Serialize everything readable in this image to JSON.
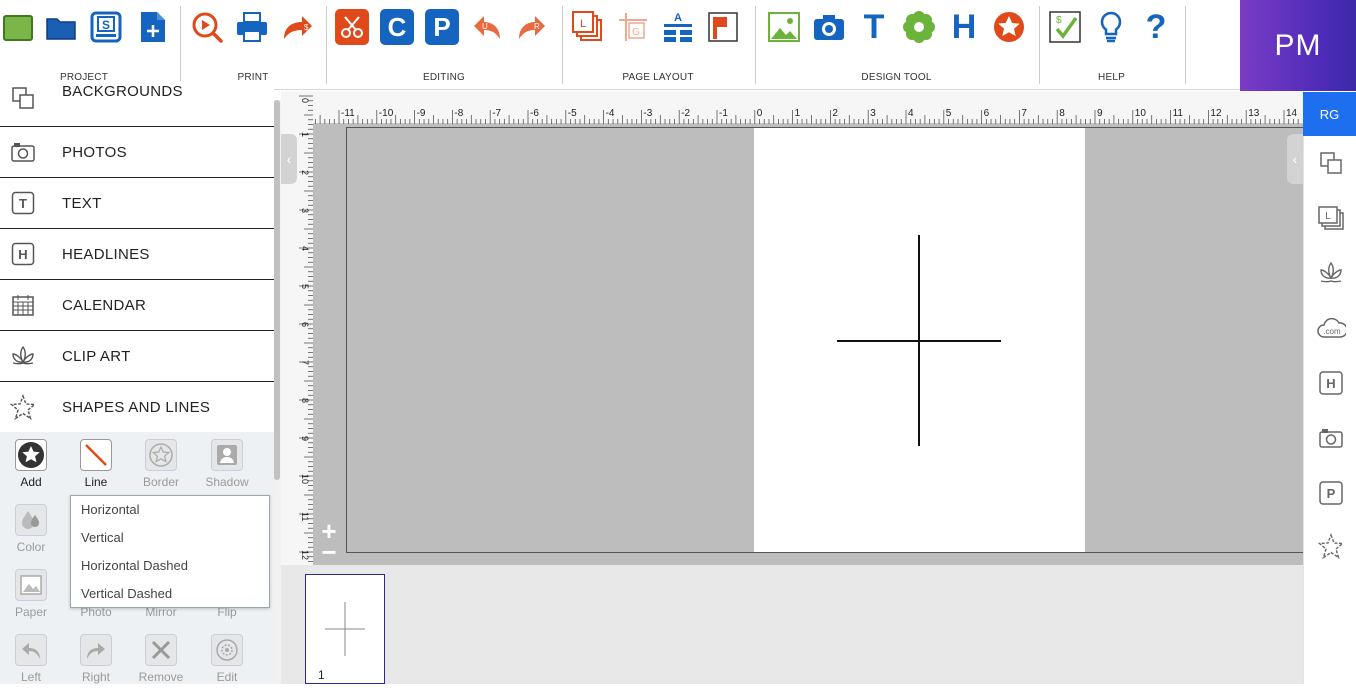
{
  "toolbar": {
    "groups": [
      {
        "label": "PROJECT"
      },
      {
        "label": "PRINT"
      },
      {
        "label": "EDITING"
      },
      {
        "label": "PAGE LAYOUT"
      },
      {
        "label": "DESIGN TOOL"
      },
      {
        "label": "HELP"
      }
    ],
    "icons": {
      "copy_c": "C",
      "paste_p": "P",
      "text_t": "T",
      "headline_h": "H",
      "question": "?",
      "layout_a": "A"
    }
  },
  "user": {
    "initials": "PM"
  },
  "left_menu": {
    "items": [
      {
        "label": "BACKGROUNDS"
      },
      {
        "label": "PHOTOS"
      },
      {
        "label": "TEXT"
      },
      {
        "label": "HEADLINES"
      },
      {
        "label": "CALENDAR"
      },
      {
        "label": "CLIP ART"
      },
      {
        "label": "SHAPES AND LINES"
      }
    ]
  },
  "shape_tools": {
    "add": "Add",
    "line": "Line",
    "border": "Border",
    "shadow": "Shadow",
    "color": "Color",
    "paper": "Paper",
    "photo": "Photo",
    "mirror": "Mirror",
    "flip": "Flip",
    "left": "Left",
    "right": "Right",
    "remove": "Remove",
    "edit": "Edit"
  },
  "line_dropdown": {
    "options": [
      "Horizontal",
      "Vertical",
      "Horizontal Dashed",
      "Vertical Dashed"
    ]
  },
  "ruler": {
    "top_labels": [
      "-11",
      "-10",
      "-9",
      "-8",
      "-7",
      "-6",
      "-5",
      "-4",
      "-3",
      "-2",
      "-1",
      "0",
      "1",
      "2",
      "3",
      "4",
      "5",
      "6",
      "7",
      "8",
      "9",
      "10",
      "11",
      "12",
      "13",
      "14"
    ],
    "left_labels": [
      "0",
      "1",
      "2",
      "3",
      "4",
      "5",
      "6",
      "7",
      "8",
      "9",
      "10",
      "11",
      "12"
    ]
  },
  "zoom": {
    "plus": "+",
    "minus": "−"
  },
  "pages": [
    {
      "number": "1"
    }
  ],
  "right_bar": {
    "rg_label": "RG",
    "h_label": "H",
    "p_label": "P",
    "com_label": ".com"
  },
  "colors": {
    "accent_blue": "#1565c0",
    "accent_red": "#e04a1a",
    "accent_green": "#6bb33a",
    "rg_blue": "#1e6ff0",
    "workspace_gray": "#bebdbe"
  }
}
